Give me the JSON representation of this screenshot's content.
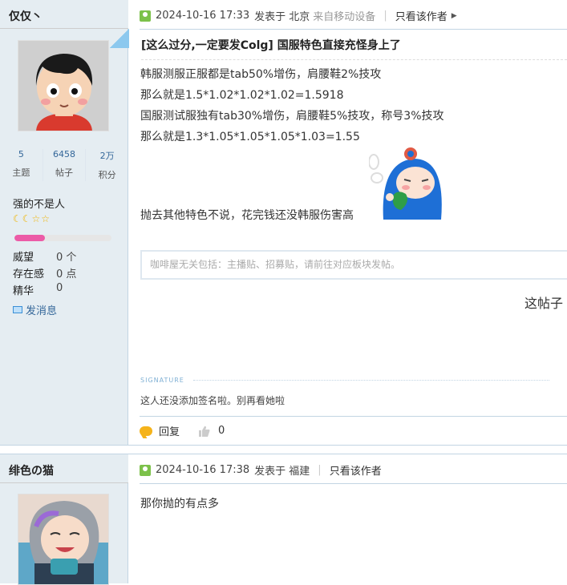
{
  "post1": {
    "username": "仅仅丶",
    "stats": [
      {
        "value": "5",
        "label": "主题"
      },
      {
        "value": "6458",
        "label": "帖子"
      },
      {
        "value": "2万",
        "label": "积分"
      }
    ],
    "group": "强的不是人",
    "level_progress": 0.31,
    "info": [
      {
        "key": "威望",
        "value": "0 个"
      },
      {
        "key": "存在感",
        "value": "0 点"
      },
      {
        "key": "精华",
        "value": "0"
      }
    ],
    "send_message": "发消息",
    "header": {
      "date": "2024-10-16 17:33",
      "posted_in": "发表于 北京",
      "source": "来自移动设备",
      "only_author": "只看该作者"
    },
    "title": "[这么过分,一定要发Colg] 国服特色直接充怪身上了",
    "body_lines": [
      "韩服测服正服都是tab50%增伤，肩腰鞋2%技攻",
      "那么就是1.5*1.02*1.02*1.02=1.5918",
      "国服测试服独有tab30%增伤，肩腰鞋5%技攻，称号3%技攻",
      "那么就是1.3*1.05*1.05*1.05*1.03=1.55"
    ],
    "body_end": "抛去其他特色不说，花完钱还没韩服伤害高",
    "reply_placeholder": "咖啡屋无关包括：主播贴、招募贴，请前往对应板块发帖。",
    "cutoff_text": "这帖子",
    "signature_label": "SIGNATURE",
    "signature": "这人还没添加签名啦。别再看她啦",
    "reply_label": "回复",
    "like_count": "0"
  },
  "post2": {
    "username": "绯色の猫",
    "header": {
      "date": "2024-10-16 17:38",
      "posted_in": "发表于 福建",
      "only_author": "只看该作者"
    },
    "body": "那你抛的有点多"
  },
  "colors": {
    "sidebar_bg": "#e5edf2",
    "border": "#c2d5e3",
    "link": "#336699",
    "level_bar": "#ec5ba7"
  }
}
